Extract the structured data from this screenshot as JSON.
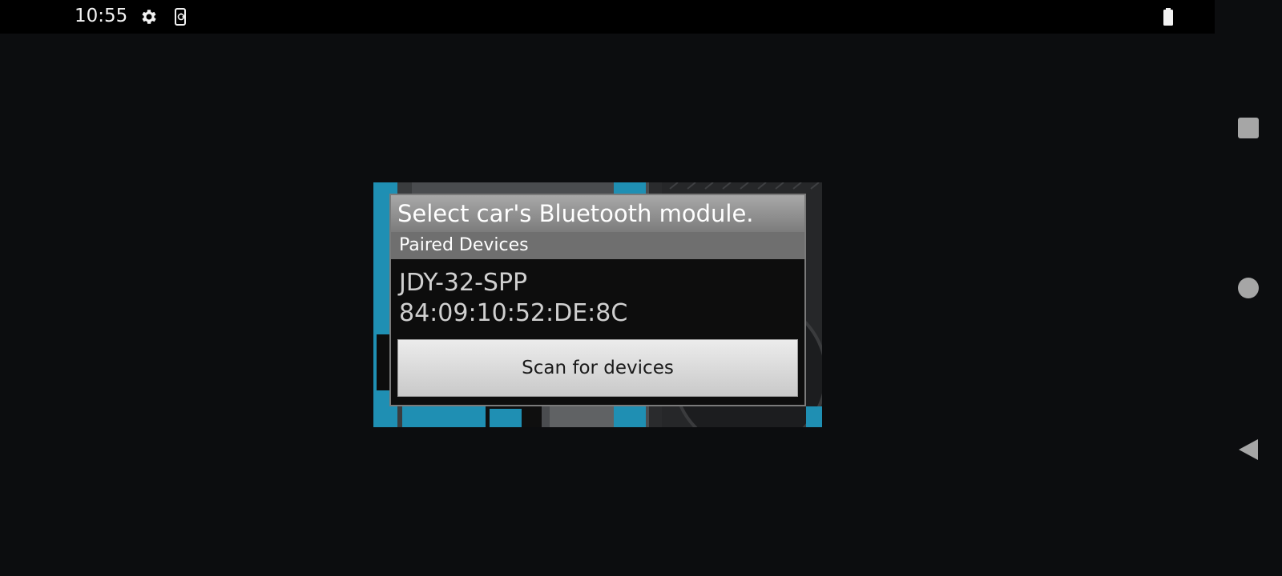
{
  "status_bar": {
    "time": "10:55",
    "icons": [
      "gear-icon",
      "phone-sync-icon",
      "battery-icon"
    ]
  },
  "navigation": {
    "buttons": [
      "recents-square-icon",
      "home-circle-icon",
      "back-triangle-icon"
    ]
  },
  "dialog": {
    "title": "Select car's Bluetooth module.",
    "section_header": "Paired Devices",
    "devices": [
      {
        "name": "JDY-32-SPP",
        "address": "84:09:10:52:DE:8C"
      }
    ],
    "scan_button_label": "Scan for devices"
  },
  "colors": {
    "background": "#0c0d0f",
    "status_bar": "#000000",
    "accent_blue": "#1f8fb3"
  }
}
